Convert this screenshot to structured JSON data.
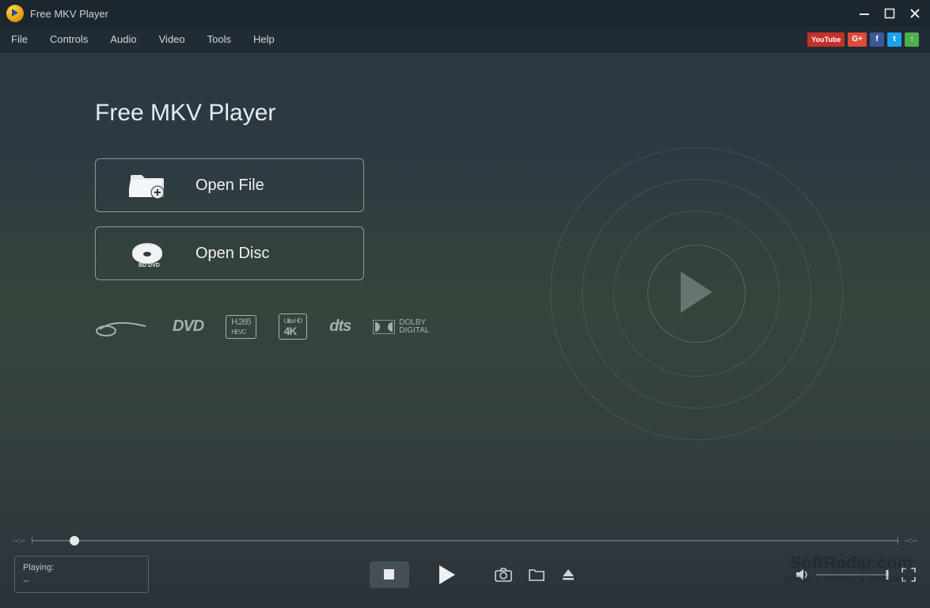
{
  "titlebar": {
    "app_name": "Free MKV Player"
  },
  "menu": {
    "items": [
      "File",
      "Controls",
      "Audio",
      "Video",
      "Tools",
      "Help"
    ]
  },
  "social": {
    "youtube": "YouTube",
    "gplus": "G+",
    "facebook": "f",
    "twitter": "t",
    "upload": "↑"
  },
  "main": {
    "headline": "Free MKV Player",
    "open_file": "Open File",
    "open_disc": "Open Disc",
    "formats": {
      "bluray": "Blu-ray",
      "dvd": "DVD",
      "h265": "H.265 HEVC",
      "uhd4k": "Ultra HD 4K",
      "dts": "dts",
      "dolby": "DOLBY DIGITAL"
    }
  },
  "status": {
    "label": "Playing:",
    "value": "--",
    "time_left": "--:--",
    "time_right": "--:--"
  },
  "watermark": {
    "line1": "SoftRadar.com",
    "line2": "Software reviews & downloads"
  }
}
